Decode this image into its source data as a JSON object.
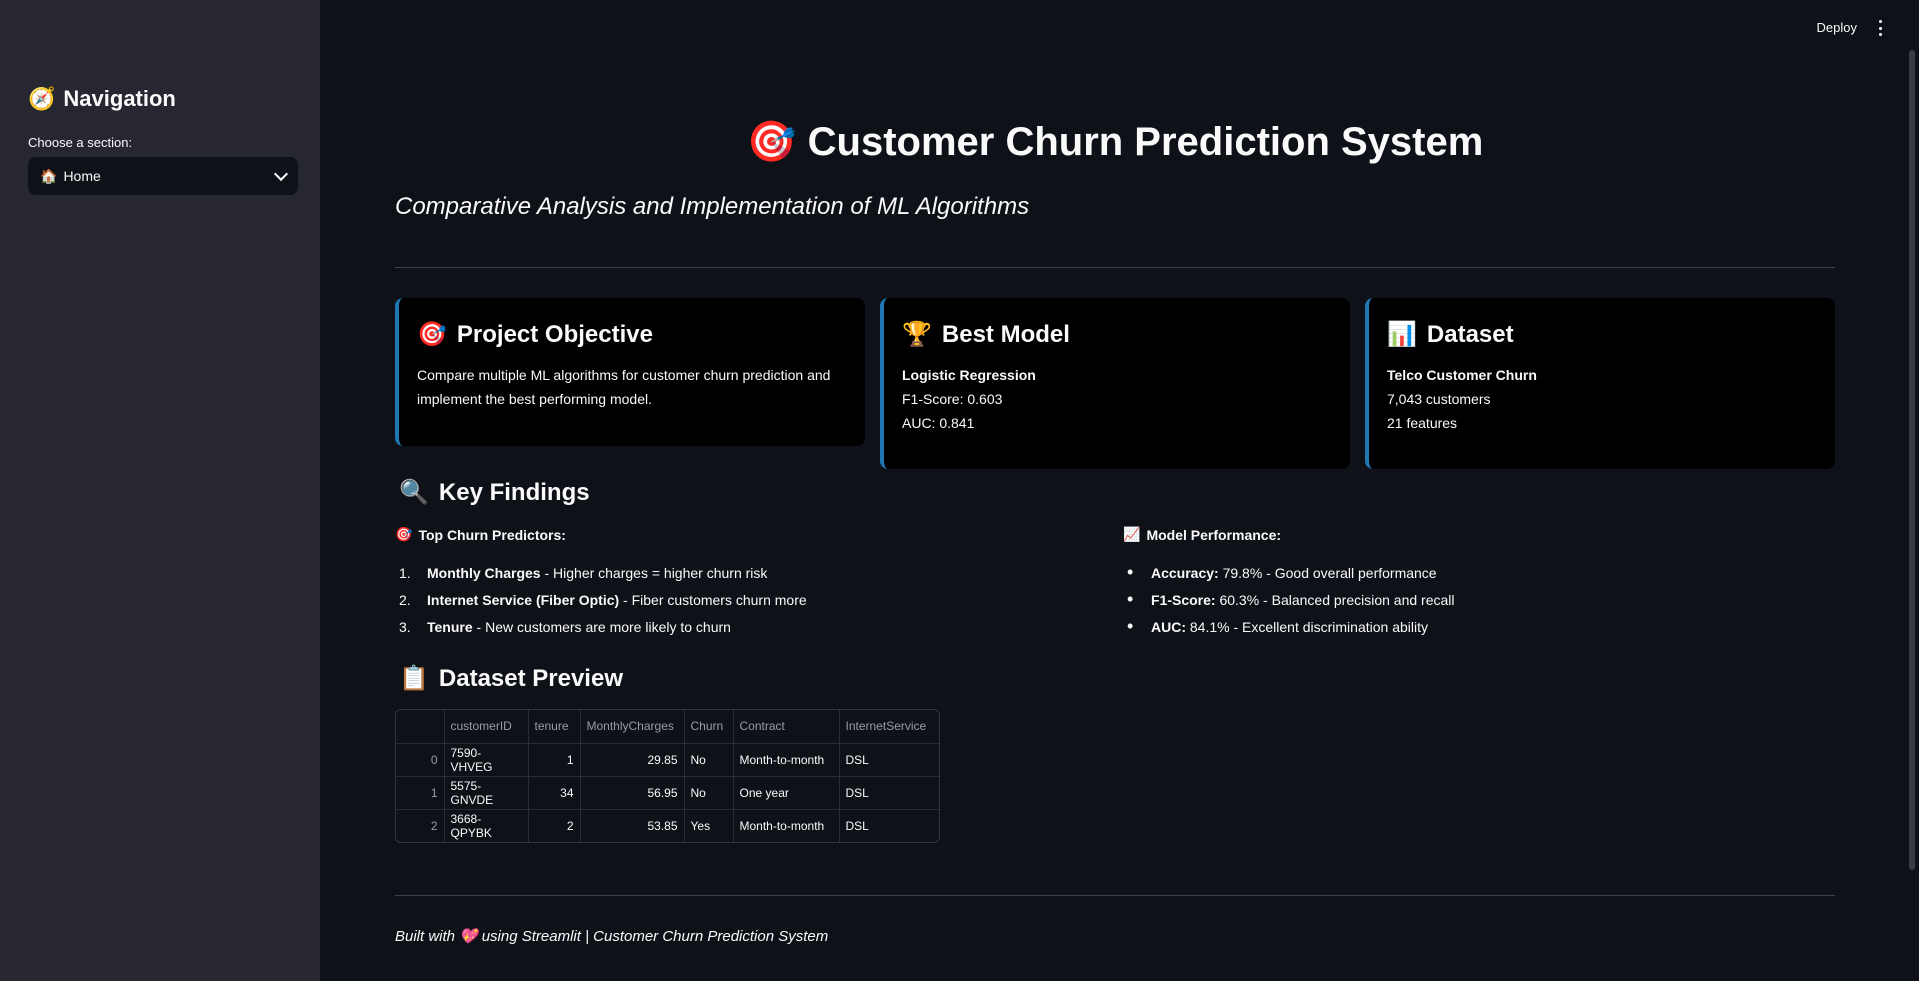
{
  "sidebar": {
    "nav_icon": "🧭",
    "nav_title": "Navigation",
    "choose_label": "Choose a section:",
    "select_icon": "🏠",
    "select_value": "Home"
  },
  "topbar": {
    "deploy": "Deploy"
  },
  "main": {
    "title_icon": "🎯",
    "title": "Customer Churn Prediction System",
    "subtitle": "Comparative Analysis and Implementation of ML Algorithms"
  },
  "cards": {
    "objective": {
      "icon": "🎯",
      "title": "Project Objective",
      "text": "Compare multiple ML algorithms for customer churn prediction and implement the best performing model."
    },
    "best_model": {
      "icon": "🏆",
      "title": "Best Model",
      "name": "Logistic Regression",
      "f1": "F1-Score: 0.603",
      "auc": "AUC: 0.841"
    },
    "dataset": {
      "icon": "📊",
      "title": "Dataset",
      "name": "Telco Customer Churn",
      "customers": "7,043 customers",
      "features": "21 features"
    }
  },
  "findings": {
    "icon": "🔍",
    "title": "Key Findings",
    "predictors_icon": "🎯",
    "predictors_title": "Top Churn Predictors:",
    "predictors": [
      {
        "num": "1.",
        "bold": "Monthly Charges",
        "text": " - Higher charges = higher churn risk"
      },
      {
        "num": "2.",
        "bold": "Internet Service (Fiber Optic)",
        "text": " - Fiber customers churn more"
      },
      {
        "num": "3.",
        "bold": "Tenure",
        "text": " - New customers are more likely to churn"
      }
    ],
    "performance_icon": "📈",
    "performance_title": "Model Performance:",
    "performance": [
      {
        "bold": "Accuracy:",
        "text": " 79.8% - Good overall performance"
      },
      {
        "bold": "F1-Score:",
        "text": " 60.3% - Balanced precision and recall"
      },
      {
        "bold": "AUC:",
        "text": " 84.1% - Excellent discrimination ability"
      }
    ]
  },
  "preview": {
    "icon": "📋",
    "title": "Dataset Preview",
    "columns": [
      "",
      "customerID",
      "tenure",
      "MonthlyCharges",
      "Churn",
      "Contract",
      "InternetService"
    ],
    "rows": [
      [
        "0",
        "7590-VHVEG",
        "1",
        "29.85",
        "No",
        "Month-to-month",
        "DSL"
      ],
      [
        "1",
        "5575-GNVDE",
        "34",
        "56.95",
        "No",
        "One year",
        "DSL"
      ],
      [
        "2",
        "3668-QPYBK",
        "2",
        "53.85",
        "Yes",
        "Month-to-month",
        "DSL"
      ]
    ]
  },
  "footer": {
    "prefix": "Built with",
    "heart": "💖",
    "suffix": "using Streamlit | Customer Churn Prediction System"
  },
  "colors": {
    "accent_border": "#1f77b4",
    "background": "#0e1117",
    "sidebar": "#262730"
  }
}
